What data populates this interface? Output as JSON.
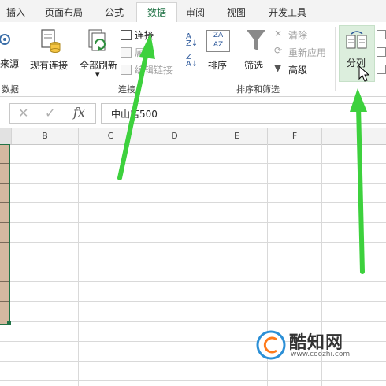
{
  "tabs": [
    "插入",
    "页面布局",
    "公式",
    "数据",
    "审阅",
    "视图",
    "开发工具"
  ],
  "active_tab": "数据",
  "ribbon": {
    "get_data_partial": "来源",
    "existing_connections": "现有连接",
    "refresh_all": "全部刷新",
    "connections": "连接",
    "properties": "属",
    "edit_links": "编辑链接",
    "group_connections": "连接",
    "group_data_partial": "数据",
    "sort": "排序",
    "filter": "筛选",
    "clear": "清除",
    "reapply": "重新应用",
    "advanced": "高级",
    "group_sort_filter": "排序和筛选",
    "text_to_columns": "分列"
  },
  "formula_bar": {
    "cancel": "✕",
    "enter": "✓",
    "fx": "fx",
    "content": "中山店500"
  },
  "columns": [
    "B",
    "C",
    "D",
    "E",
    "F"
  ],
  "watermark": {
    "name": "酷知网",
    "url": "www.coozhi.com"
  },
  "colors": {
    "accent": "#217346",
    "arrow": "#3dd13d",
    "selected_cells": "#d4b8a0"
  }
}
